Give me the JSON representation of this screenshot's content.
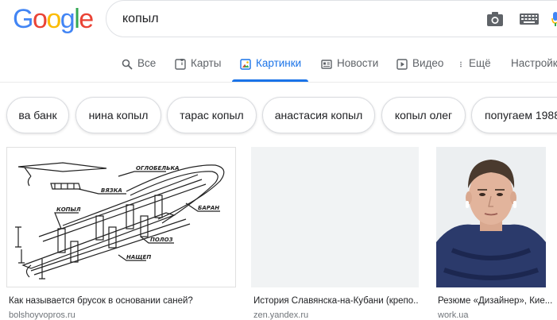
{
  "header": {
    "logo_letters": [
      "G",
      "o",
      "o",
      "g",
      "l",
      "e"
    ],
    "query": "копыл"
  },
  "tabs": [
    {
      "label": "Все",
      "icon": "search-icon"
    },
    {
      "label": "Карты",
      "icon": "map-icon"
    },
    {
      "label": "Картинки",
      "icon": "image-icon",
      "active": true
    },
    {
      "label": "Новости",
      "icon": "news-icon"
    },
    {
      "label": "Видео",
      "icon": "video-icon"
    },
    {
      "label": "Ещё",
      "icon": "more-icon"
    },
    {
      "label": "Настройки",
      "icon": ""
    }
  ],
  "chips": [
    "ва банк",
    "нина копыл",
    "тарас копыл",
    "анастасия копыл",
    "копыл олег",
    "попугаем 1988"
  ],
  "results": [
    {
      "caption": "Как называется брусок в основании саней?",
      "source": "bolshoyvopros.ru",
      "diagram_labels": [
        "ОГЛОБЕЛЬКА",
        "ВЯЗКА",
        "КОПЫЛ",
        "БАРАН",
        "ПОЛОЗ",
        "НАЩЕП"
      ]
    },
    {
      "caption": "История Славянска-на-Кубани (крепо...",
      "source": "zen.yandex.ru"
    },
    {
      "caption": "Резюме «Дизайнер», Кие...",
      "source": "work.ua"
    }
  ],
  "colors": {
    "accent": "#1a73e8",
    "tab_text": "#5f6368",
    "source_text": "#70757a"
  }
}
